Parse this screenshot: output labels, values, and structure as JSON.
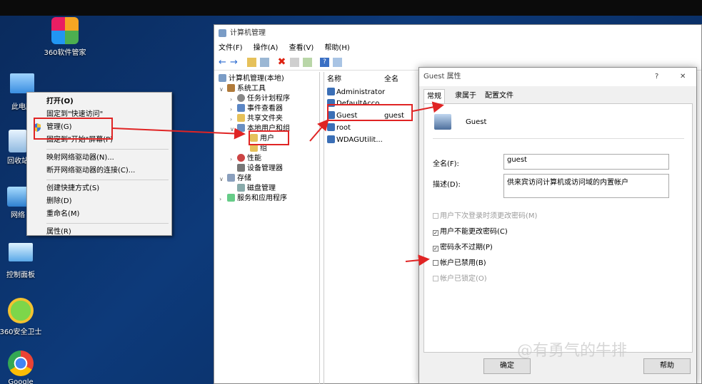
{
  "desktop": {
    "icons": [
      {
        "label": "360软件管家"
      },
      {
        "label": "此电脑"
      },
      {
        "label": "回收站"
      },
      {
        "label": "网络"
      },
      {
        "label": "控制面板"
      },
      {
        "label": "360安全卫士"
      },
      {
        "label": "Google"
      }
    ]
  },
  "context_menu": {
    "items": [
      "打开(O)",
      "固定到\"快速访问\"",
      "管理(G)",
      "固定到\"开始\"屏幕(P)",
      "映射网络驱动器(N)...",
      "断开网络驱动器的连接(C)...",
      "创建快捷方式(S)",
      "删除(D)",
      "重命名(M)",
      "属性(R)"
    ]
  },
  "cm_window": {
    "title": "计算机管理",
    "menu": [
      "文件(F)",
      "操作(A)",
      "查看(V)",
      "帮助(H)"
    ],
    "tree": [
      "计算机管理(本地)",
      "系统工具",
      "任务计划程序",
      "事件查看器",
      "共享文件夹",
      "本地用户和组",
      "用户",
      "组",
      "性能",
      "设备管理器",
      "存储",
      "磁盘管理",
      "服务和应用程序"
    ],
    "list_headers": [
      "名称",
      "全名"
    ],
    "users": [
      {
        "name": "Administrator",
        "full": ""
      },
      {
        "name": "DefaultAcco...",
        "full": ""
      },
      {
        "name": "Guest",
        "full": "guest"
      },
      {
        "name": "root",
        "full": ""
      },
      {
        "name": "WDAGUtilit...",
        "full": ""
      }
    ]
  },
  "dialog": {
    "title": "Guest 属性",
    "help": "?",
    "close": "✕",
    "tabs": [
      "常规",
      "隶属于",
      "配置文件"
    ],
    "user_name": "Guest",
    "fullname_label": "全名(F):",
    "fullname_value": "guest",
    "desc_label": "描述(D):",
    "desc_value": "供来宾访问计算机或访问域的内置帐户",
    "checkboxes": [
      {
        "label": "用户下次登录时须更改密码(M)",
        "checked": false,
        "disabled": true
      },
      {
        "label": "用户不能更改密码(C)",
        "checked": true,
        "disabled": false
      },
      {
        "label": "密码永不过期(P)",
        "checked": true,
        "disabled": false
      },
      {
        "label": "帐户已禁用(B)",
        "checked": false,
        "disabled": false
      },
      {
        "label": "帐户已锁定(O)",
        "checked": false,
        "disabled": true
      }
    ],
    "ok_label": "确定",
    "help_label": "帮助"
  },
  "watermark": "@有勇气的牛排",
  "colors": {
    "annotation_red": "#e02424",
    "desktop_blue": "#0d3a7a"
  }
}
